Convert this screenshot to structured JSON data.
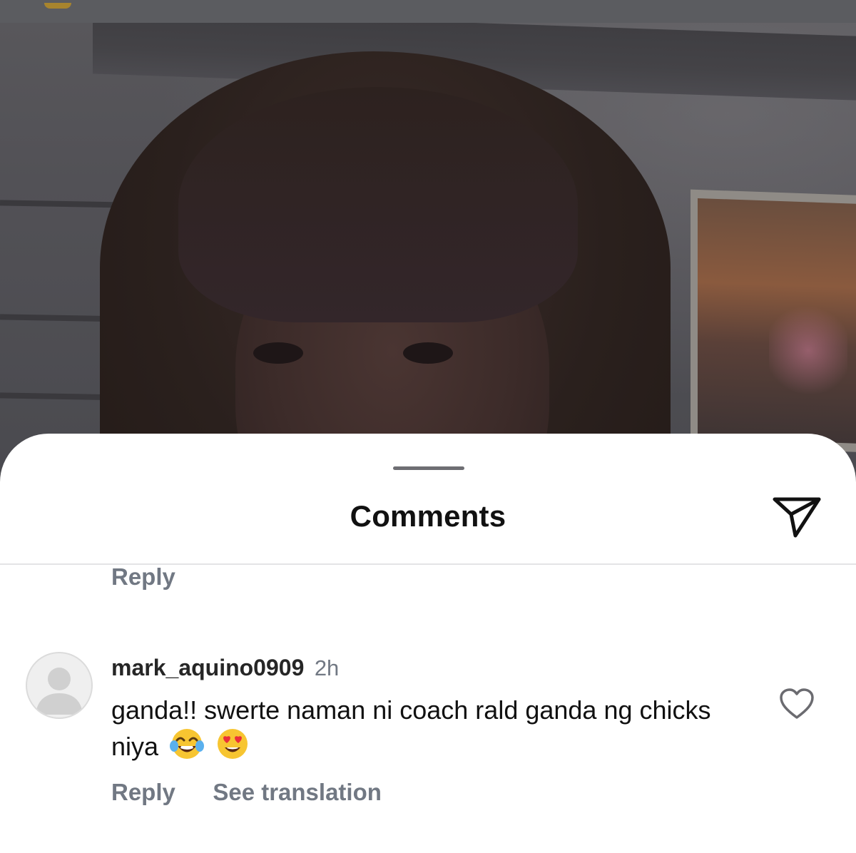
{
  "sheet": {
    "title": "Comments"
  },
  "previous_comment": {
    "reply_label": "Reply"
  },
  "comment": {
    "username": "mark_aquino0909",
    "time": "2h",
    "text": "ganda!! swerte naman ni coach rald ganda ng chicks niya",
    "emojis": [
      "face-with-tears-of-joy",
      "smiling-face-with-heart-eyes"
    ],
    "reply_label": "Reply",
    "translation_label": "See translation"
  },
  "icons": {
    "share": "paper-plane-icon",
    "like": "heart-outline-icon",
    "avatar": "default-avatar-icon"
  },
  "colors": {
    "secondary_text": "#717883",
    "primary_text": "#111111",
    "sheet_background": "#ffffff"
  }
}
